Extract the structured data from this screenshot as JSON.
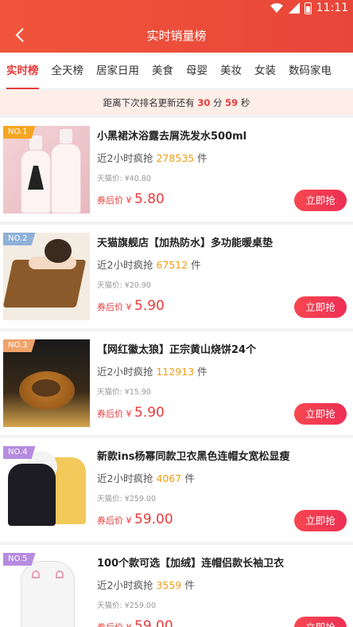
{
  "status": {
    "time": "11:11"
  },
  "header": {
    "title": "实时销量榜"
  },
  "tabs": [
    {
      "label": "实时榜",
      "active": true
    },
    {
      "label": "全天榜"
    },
    {
      "label": "居家日用"
    },
    {
      "label": "美食"
    },
    {
      "label": "母婴"
    },
    {
      "label": "美妆"
    },
    {
      "label": "女装"
    },
    {
      "label": "数码家电"
    }
  ],
  "countdown": {
    "prefix": "距离下次排名更新还有",
    "minutes": "30",
    "min_unit": "分",
    "seconds": "59",
    "sec_unit": "秒"
  },
  "labels": {
    "sales_prefix": "近2小时疯抢",
    "sales_unit": "件",
    "after_prefix": "券后价",
    "currency": "¥",
    "buy": "立即抢"
  },
  "items": [
    {
      "rank": "NO.1",
      "rank_color": "#f5a623",
      "title": "小黑裙沐浴露去屑洗发水500ml",
      "sales": "278535",
      "original": "天猫价: ¥40.80",
      "price": "5.80"
    },
    {
      "rank": "NO.2",
      "rank_color": "#8fb0d8",
      "title": "天猫旗舰店【加热防水】多功能暖桌垫",
      "sales": "67512",
      "original": "天猫价: ¥20.90",
      "price": "5.90"
    },
    {
      "rank": "NO.3",
      "rank_color": "#f0a36a",
      "title": "【网红徽太狼】正宗黄山烧饼24个",
      "sales": "112913",
      "original": "天猫价: ¥15.90",
      "price": "5.90"
    },
    {
      "rank": "NO.4",
      "rank_color": "#b58ce0",
      "title": "新款ins杨幂同款卫衣黑色连帽女宽松显瘦",
      "sales": "4067",
      "original": "天猫价: ¥259.00",
      "price": "59.00"
    },
    {
      "rank": "NO.5",
      "rank_color": "#b58ce0",
      "title": "100个款可选【加绒】连帽侣款长袖卫衣",
      "sales": "3559",
      "original": "天猫价: ¥259.00",
      "price": "59.00"
    }
  ]
}
